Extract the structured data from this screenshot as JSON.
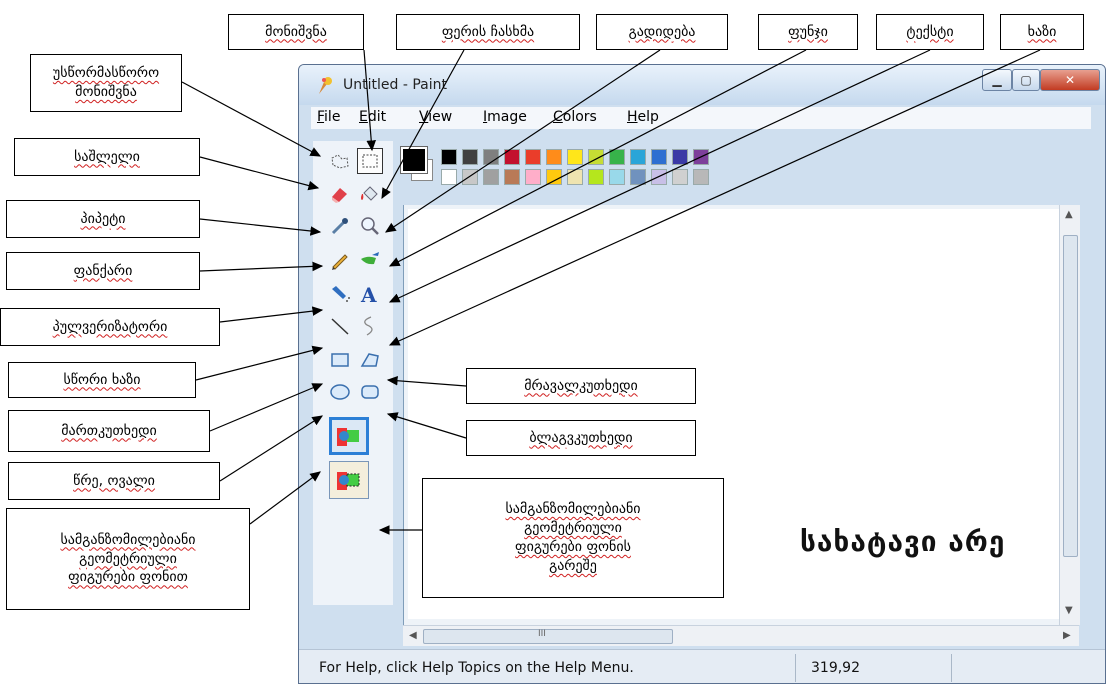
{
  "window": {
    "title": "Untitled - Paint",
    "menu": [
      "File",
      "Edit",
      "View",
      "Image",
      "Colors",
      "Help"
    ],
    "status_text": "For Help, click Help Topics on the Help Menu.",
    "coordinates": "319,92",
    "scroll_center": "III"
  },
  "canvas": {
    "text": "სახატავი არე"
  },
  "palette": {
    "foreground": "#000000",
    "background": "#ffffff",
    "row1": [
      "#000000",
      "#404040",
      "#7f7f7f",
      "#c3112e",
      "#ea3d2a",
      "#ff8c1a",
      "#ffe61a",
      "#c6dd34",
      "#37b34a",
      "#2aa5d8",
      "#2d6fd1",
      "#3a3aa6",
      "#7d3f9b"
    ],
    "row2": [
      "#ffffff",
      "#c8c8c8",
      "#a0a0a0",
      "#b97a57",
      "#ffaec9",
      "#ffc90e",
      "#efe4b0",
      "#b5e61d",
      "#99d9ea",
      "#7092be",
      "#c8bfe7",
      "#d0d0d0",
      "#b8b8b8"
    ]
  },
  "callouts": {
    "selection": "მონიშვნა",
    "color_pick": "ფერის ჩასხმა",
    "magnify": "გადიდება",
    "brush": "ფუნჯი",
    "text": "ტექსტი",
    "line": "ხაზი",
    "free_select": "უსწორმასწორო\nმონიშვნა",
    "eraser": "საშლელი",
    "pipette": "პიპეტი",
    "pencil": "ფანქარი",
    "airbrush": "პულვერიზატორი",
    "straight_line": "სწორი ხაზი",
    "rectangle": "მართკუთხედი",
    "ellipse": "წრე, ოვალი",
    "with_bg": "სამგანზომილებიანი\nგეომეტრიული\nფიგურები ფონით",
    "polygon": "მრავალკუთხედი",
    "rounded_rect": "ბლაგვკუთხედი",
    "no_bg": "სამგანზომილებიანი\nგეომეტრიული\nფიგურები ფონის\nგარეშე"
  }
}
